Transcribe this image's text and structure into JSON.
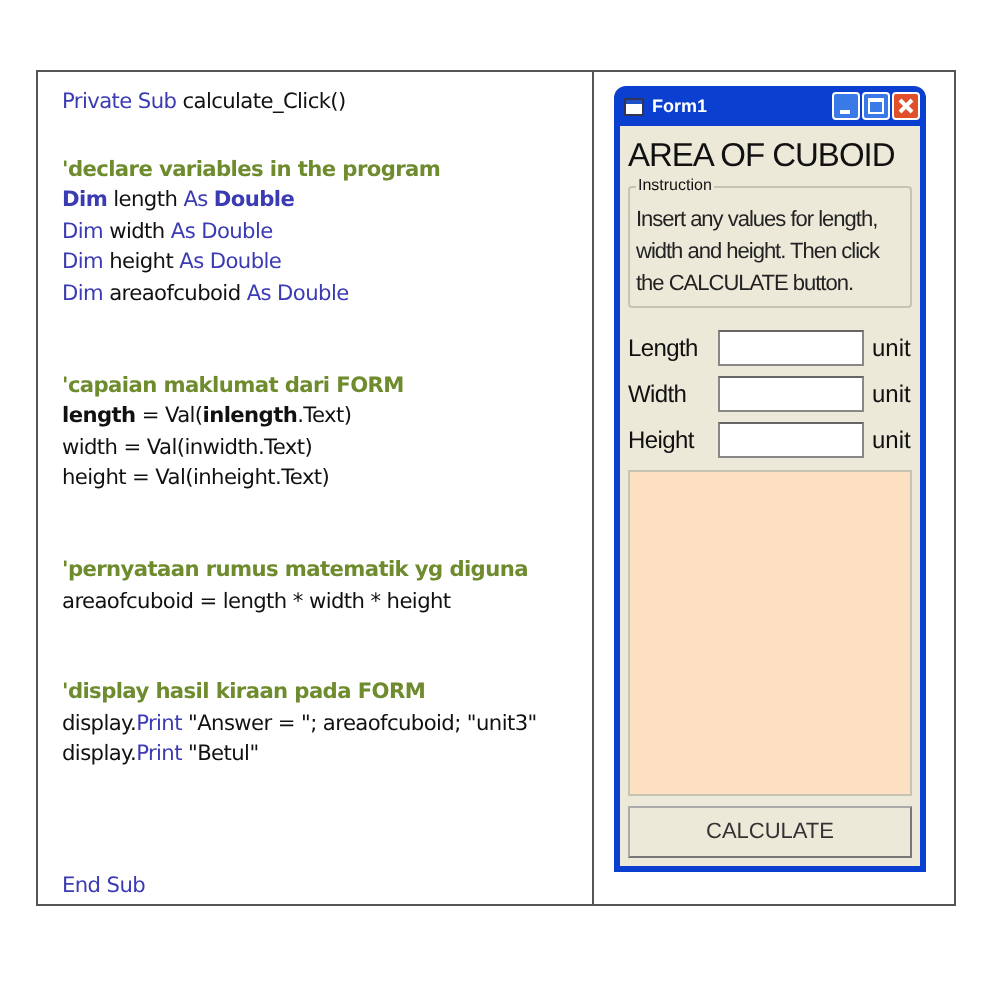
{
  "code": {
    "blocks": [
      [
        {
          "segments": [
            {
              "kind": "keyword",
              "text": "Private Sub"
            },
            {
              "kind": "plain",
              "text": " calculate_Click()"
            }
          ]
        }
      ],
      [
        {
          "segments": [
            {
              "kind": "comment",
              "text": "'declare variables in the program"
            }
          ]
        },
        {
          "segments": [
            {
              "kind": "keyword",
              "text": "**Dim**"
            },
            {
              "kind": "plain",
              "text": " length "
            },
            {
              "kind": "keyword",
              "text": "As **Double**"
            }
          ]
        },
        {
          "segments": [
            {
              "kind": "keyword",
              "text": "Dim"
            },
            {
              "kind": "plain",
              "text": " width "
            },
            {
              "kind": "keyword",
              "text": "As Double"
            }
          ]
        },
        {
          "segments": [
            {
              "kind": "keyword",
              "text": "Dim"
            },
            {
              "kind": "plain",
              "text": " height "
            },
            {
              "kind": "keyword",
              "text": "As Double"
            }
          ]
        },
        {
          "segments": [
            {
              "kind": "keyword",
              "text": "Dim"
            },
            {
              "kind": "plain",
              "text": " areaofcuboid "
            },
            {
              "kind": "keyword",
              "text": "As Double"
            }
          ]
        }
      ],
      [
        {
          "segments": [
            {
              "kind": "comment",
              "text": "'capaian maklumat dari FORM"
            }
          ]
        },
        {
          "segments": [
            {
              "kind": "plain",
              "text": "**length** = Val(**inlength**.Text)"
            }
          ]
        },
        {
          "segments": [
            {
              "kind": "plain",
              "text": "width = Val(inwidth.Text)"
            }
          ]
        },
        {
          "segments": [
            {
              "kind": "plain",
              "text": "height = Val(inheight.Text)"
            }
          ]
        }
      ],
      [
        {
          "segments": [
            {
              "kind": "comment",
              "text": "'pernyataan rumus matematik yg diguna"
            }
          ]
        },
        {
          "segments": [
            {
              "kind": "plain",
              "text": "areaofcuboid = length * width * height"
            }
          ]
        }
      ],
      [
        {
          "segments": [
            {
              "kind": "comment",
              "text": "'display hasil kiraan pada FORM"
            }
          ]
        },
        {
          "segments": [
            {
              "kind": "plain",
              "text": "display."
            },
            {
              "kind": "keyword",
              "text": "Print"
            },
            {
              "kind": "plain",
              "text": " \"Answer = \"; areaofcuboid; \"unit3\""
            }
          ]
        },
        {
          "segments": [
            {
              "kind": "plain",
              "text": "display."
            },
            {
              "kind": "keyword",
              "text": "Print"
            },
            {
              "kind": "plain",
              "text": " \"Betul\""
            }
          ]
        }
      ],
      [
        {
          "segments": [
            {
              "kind": "keyword",
              "text": "End Sub"
            }
          ]
        }
      ]
    ]
  },
  "window": {
    "title": "Form1",
    "heading": "AREA OF CUBOID",
    "instruction": {
      "legend": "Instruction",
      "text": "Insert any values for length, width and height. Then click the CALCULATE button."
    },
    "fields": [
      {
        "label": "Length",
        "unit": "unit"
      },
      {
        "label": "Width",
        "unit": "unit"
      },
      {
        "label": "Height",
        "unit": "unit"
      }
    ],
    "button": "CALCULATE"
  }
}
